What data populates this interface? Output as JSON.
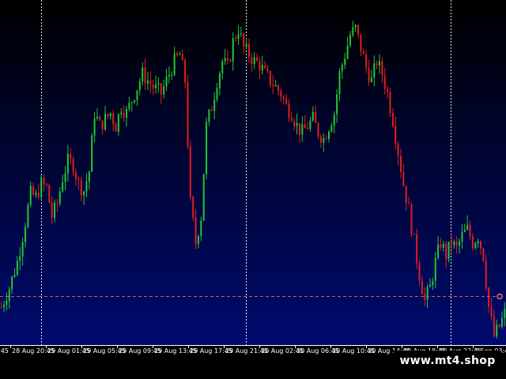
{
  "watermark": "www.mt4.shop",
  "colors": {
    "background_top": "#000000",
    "background_bottom": "#000a6e",
    "bull": "#22c832",
    "bear": "#e01e1e",
    "grid": "#ffffff",
    "price_line": "#e05a3c",
    "marker": "#ff6464"
  },
  "chart_data": {
    "type": "candlestick",
    "grid": true,
    "x_tick_labels": [
      "28 Aug 20:45",
      "29 Aug 01:45",
      "29 Aug 05:45",
      "29 Aug 09:45",
      "29 Aug 13:45",
      "29 Aug 17:45",
      "29 Aug 21:45",
      "30 Aug 02:45",
      "30 Aug 06:45",
      "30 Aug 10:45",
      "30 Aug 14:45",
      "30 Aug 18:45",
      "30 Aug 22:45",
      "2 Sep 03:45"
    ],
    "x_tick_partial_left": ":45",
    "close_path": [
      [
        0,
        0.1
      ],
      [
        3,
        0.16
      ],
      [
        6,
        0.24
      ],
      [
        8,
        0.32
      ],
      [
        11,
        0.45
      ],
      [
        13,
        0.44
      ],
      [
        15,
        0.48
      ],
      [
        17,
        0.47
      ],
      [
        19,
        0.38
      ],
      [
        21,
        0.42
      ],
      [
        23,
        0.5
      ],
      [
        25,
        0.55
      ],
      [
        27,
        0.54
      ],
      [
        29,
        0.48
      ],
      [
        31,
        0.46
      ],
      [
        33,
        0.52
      ],
      [
        35,
        0.7
      ],
      [
        37,
        0.66
      ],
      [
        39,
        0.68
      ],
      [
        41,
        0.7
      ],
      [
        43,
        0.66
      ],
      [
        45,
        0.72
      ],
      [
        47,
        0.7
      ],
      [
        50,
        0.76
      ],
      [
        53,
        0.82
      ],
      [
        55,
        0.8
      ],
      [
        57,
        0.78
      ],
      [
        60,
        0.76
      ],
      [
        63,
        0.82
      ],
      [
        65,
        0.86
      ],
      [
        67,
        0.88
      ],
      [
        69,
        0.8
      ],
      [
        71,
        0.42
      ],
      [
        73,
        0.3
      ],
      [
        75,
        0.38
      ],
      [
        77,
        0.66
      ],
      [
        79,
        0.72
      ],
      [
        81,
        0.8
      ],
      [
        83,
        0.86
      ],
      [
        85,
        0.84
      ],
      [
        87,
        0.92
      ],
      [
        89,
        0.96
      ],
      [
        91,
        0.9
      ],
      [
        93,
        0.88
      ],
      [
        95,
        0.86
      ],
      [
        97,
        0.85
      ],
      [
        99,
        0.82
      ],
      [
        101,
        0.8
      ],
      [
        103,
        0.78
      ],
      [
        105,
        0.76
      ],
      [
        107,
        0.72
      ],
      [
        109,
        0.7
      ],
      [
        111,
        0.66
      ],
      [
        113,
        0.64
      ],
      [
        115,
        0.66
      ],
      [
        117,
        0.68
      ],
      [
        119,
        0.64
      ],
      [
        121,
        0.62
      ],
      [
        123,
        0.66
      ],
      [
        125,
        0.7
      ],
      [
        127,
        0.82
      ],
      [
        129,
        0.88
      ],
      [
        131,
        0.94
      ],
      [
        133,
        0.96
      ],
      [
        135,
        0.9
      ],
      [
        137,
        0.84
      ],
      [
        139,
        0.8
      ],
      [
        141,
        0.86
      ],
      [
        143,
        0.82
      ],
      [
        145,
        0.76
      ],
      [
        147,
        0.68
      ],
      [
        149,
        0.58
      ],
      [
        151,
        0.48
      ],
      [
        153,
        0.4
      ],
      [
        155,
        0.3
      ],
      [
        157,
        0.2
      ],
      [
        159,
        0.12
      ],
      [
        161,
        0.16
      ],
      [
        163,
        0.24
      ],
      [
        165,
        0.3
      ],
      [
        167,
        0.26
      ],
      [
        169,
        0.3
      ],
      [
        171,
        0.28
      ],
      [
        173,
        0.32
      ],
      [
        175,
        0.34
      ],
      [
        177,
        0.3
      ],
      [
        179,
        0.32
      ],
      [
        181,
        0.26
      ],
      [
        183,
        0.1
      ],
      [
        185,
        0.01
      ],
      [
        187,
        0.04
      ],
      [
        189,
        0.08
      ]
    ],
    "bar_count": 190,
    "current_price_level": 0.102
  }
}
